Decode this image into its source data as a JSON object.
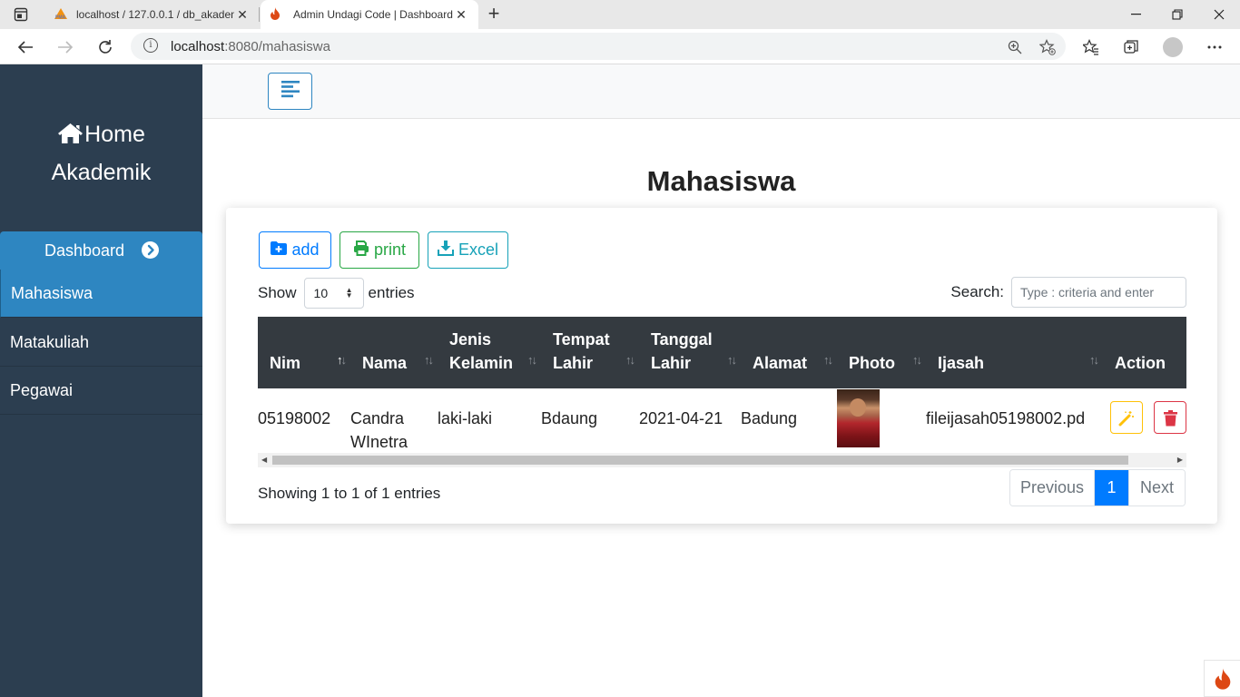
{
  "browser": {
    "tabs": [
      {
        "title": "localhost / 127.0.0.1 / db_akadem",
        "icon": "phpmyadmin-icon",
        "active": false
      },
      {
        "title": "Admin Undagi Code | Dashboard",
        "icon": "codeigniter-flame-icon",
        "active": true
      }
    ],
    "url_host": "localhost",
    "url_rest": ":8080/mahasiswa"
  },
  "sidebar": {
    "brand_line1": "Home",
    "brand_line2": "Akademik",
    "dashboard_label": "Dashboard",
    "items": [
      {
        "label": "Mahasiswa",
        "active": true
      },
      {
        "label": "Matakuliah",
        "active": false
      },
      {
        "label": "Pegawai",
        "active": false
      }
    ]
  },
  "page": {
    "title": "Mahasiswa",
    "buttons": {
      "add": "add",
      "print": "print",
      "excel": "Excel"
    },
    "show_label": "Show",
    "entries_label": "entries",
    "page_length": "10",
    "search_label": "Search:",
    "search_placeholder": "Type : criteria and enter",
    "table": {
      "headers": [
        {
          "label": "Nim",
          "sorted": "asc"
        },
        {
          "label": "Nama",
          "sorted": null
        },
        {
          "label": "Jenis Kelamin",
          "sorted": null
        },
        {
          "label": "Tempat Lahir",
          "sorted": null
        },
        {
          "label": "Tanggal Lahir",
          "sorted": null
        },
        {
          "label": "Alamat",
          "sorted": null
        },
        {
          "label": "Photo",
          "sorted": null
        },
        {
          "label": "Ijasah",
          "sorted": null
        },
        {
          "label": "Action",
          "sorted": null
        }
      ],
      "rows": [
        {
          "nim": "05198002",
          "nama": "Candra WInetra",
          "jenis_kelamin": "laki-laki",
          "tempat_lahir": "Bdaung",
          "tanggal_lahir": "2021-04-21",
          "alamat": "Badung",
          "photo": "portrait-photo",
          "ijasah": "fileijasah05198002.pd"
        }
      ]
    },
    "info": "Showing 1 to 1 of 1 entries",
    "pagination": {
      "previous": "Previous",
      "current": "1",
      "next": "Next"
    }
  },
  "colors": {
    "sidebar_bg": "#2c3e50",
    "sidebar_active": "#2e86c1",
    "table_head": "#343a40",
    "primary": "#007bff",
    "success": "#28a745",
    "info": "#17a2b8",
    "warning": "#ffc107",
    "danger": "#dc3545"
  }
}
